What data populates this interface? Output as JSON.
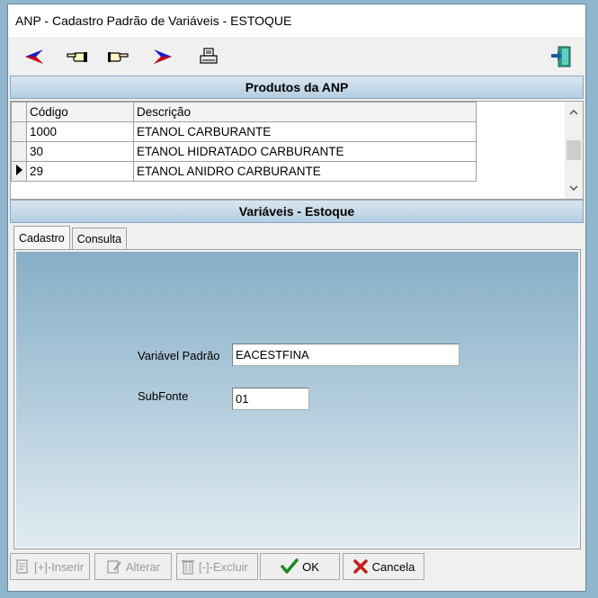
{
  "window": {
    "title": "ANP - Cadastro Padrão de Variáveis -  ESTOQUE"
  },
  "toolbar": {
    "buttons": [
      {
        "icon": "arrow-left-icon",
        "glyph": "➤"
      },
      {
        "icon": "hand-left-icon",
        "glyph": "☜"
      },
      {
        "icon": "hand-right-icon",
        "glyph": "☞"
      },
      {
        "icon": "arrow-right-icon",
        "glyph": "➤"
      },
      {
        "icon": "printer-icon",
        "glyph": "🖶"
      },
      {
        "icon": "exit-door-icon",
        "glyph": "⇥"
      }
    ]
  },
  "products": {
    "header": "Produtos da ANP",
    "columns": [
      "Código",
      "Descrição"
    ],
    "rows": [
      {
        "code": "1000",
        "desc": "ETANOL CARBURANTE",
        "current": false
      },
      {
        "code": "30",
        "desc": "ETANOL HIDRATADO CARBURANTE",
        "current": false
      },
      {
        "code": "29",
        "desc": "ETANOL ANIDRO CARBURANTE",
        "current": true
      }
    ]
  },
  "variables": {
    "header": "Variáveis - Estoque",
    "tabs": [
      "Cadastro",
      "Consulta"
    ],
    "active_tab": "Cadastro",
    "form": {
      "variavel_label": "Variável Padrão",
      "variavel_value": "EACESTFINA",
      "subfonte_label": "SubFonte",
      "subfonte_value": "01"
    }
  },
  "actions": {
    "inserir": "[+]-Inserir",
    "alterar": "Alterar",
    "excluir": "[-]-Excluir",
    "ok": "OK",
    "cancela": "Cancela"
  },
  "colors": {
    "arrow_blue": "#1a1acc",
    "ok_green": "#1a8a1a",
    "cancel_red": "#cc1a1a"
  }
}
